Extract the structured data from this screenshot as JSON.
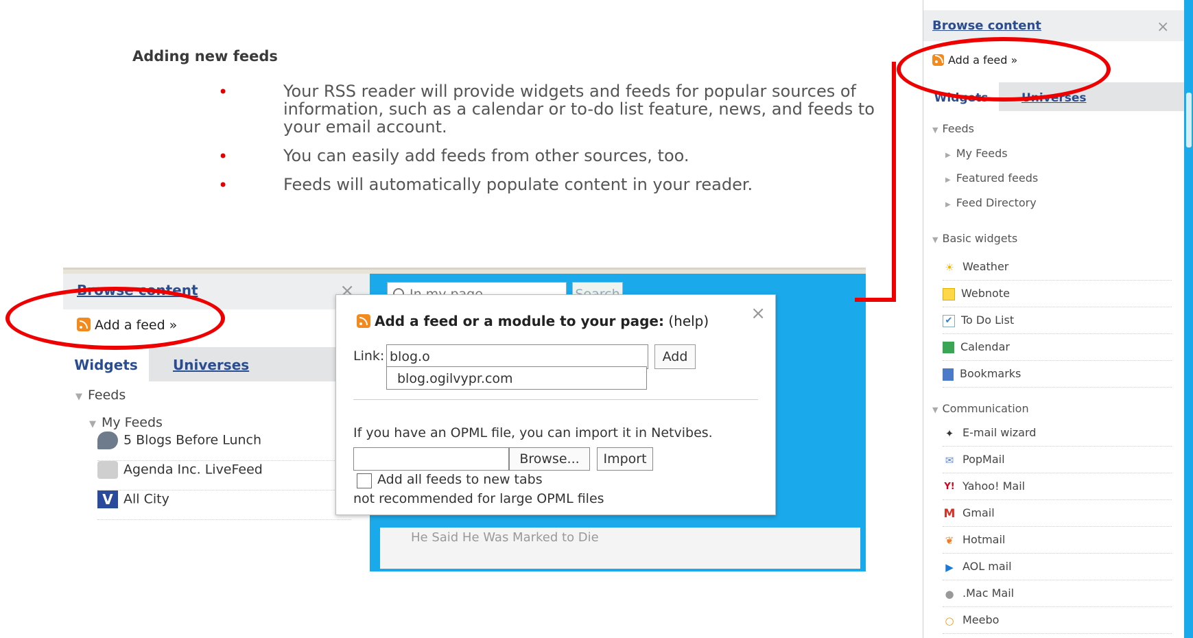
{
  "slide": {
    "title": "Adding new feeds",
    "bullets": [
      "Your RSS reader will provide widgets and feeds for popular sources of information, such as a calendar or to-do list feature, news, and feeds to your email account.",
      "You can easily add feeds from other sources, too.",
      "Feeds will automatically populate content in your reader."
    ]
  },
  "left_panel": {
    "title": "Browse content",
    "close": "×",
    "add_feed": "Add a feed »",
    "tabs": [
      "Widgets",
      "Universes"
    ],
    "tree": {
      "feeds": "Feeds",
      "my_feeds": "My Feeds",
      "items": [
        "5 Blogs Before Lunch",
        "Agenda Inc. LiveFeed",
        "All City"
      ]
    },
    "search_placeholder": "In my page",
    "search_button": "Search",
    "strip_text": "He Said He Was Marked to Die"
  },
  "popup": {
    "title_bold": "Add a feed or a module to your page:",
    "title_help": "(help)",
    "close": "×",
    "link_label": "Link:",
    "link_value": "blog.o",
    "add_button": "Add",
    "suggestion": "blog.ogilvypr.com",
    "opml_text": "If you have an OPML file, you can import it in Netvibes.",
    "browse_button": "Browse...",
    "import_button": "Import",
    "checkbox_label": "Add all feeds to new tabs",
    "note": "not recommended for large OPML files"
  },
  "right_sidebar": {
    "title": "Browse content",
    "close": "×",
    "add_feed": "Add a feed »",
    "tabs": [
      "Widgets",
      "Universes"
    ],
    "sections": {
      "feeds": "Feeds",
      "feed_items": [
        "My Feeds",
        "Featured feeds",
        "Feed Directory"
      ],
      "basic": "Basic widgets",
      "basic_items": [
        "Weather",
        "Webnote",
        "To Do List",
        "Calendar",
        "Bookmarks"
      ],
      "comm": "Communication",
      "comm_items": [
        "E-mail wizard",
        "PopMail",
        "Yahoo! Mail",
        "Gmail",
        "Hotmail",
        "AOL mail",
        ".Mac Mail",
        "Meebo"
      ]
    }
  },
  "colors": {
    "accent": "#1aa9ea",
    "highlight": "#e00000",
    "link": "#2b4d8f"
  }
}
